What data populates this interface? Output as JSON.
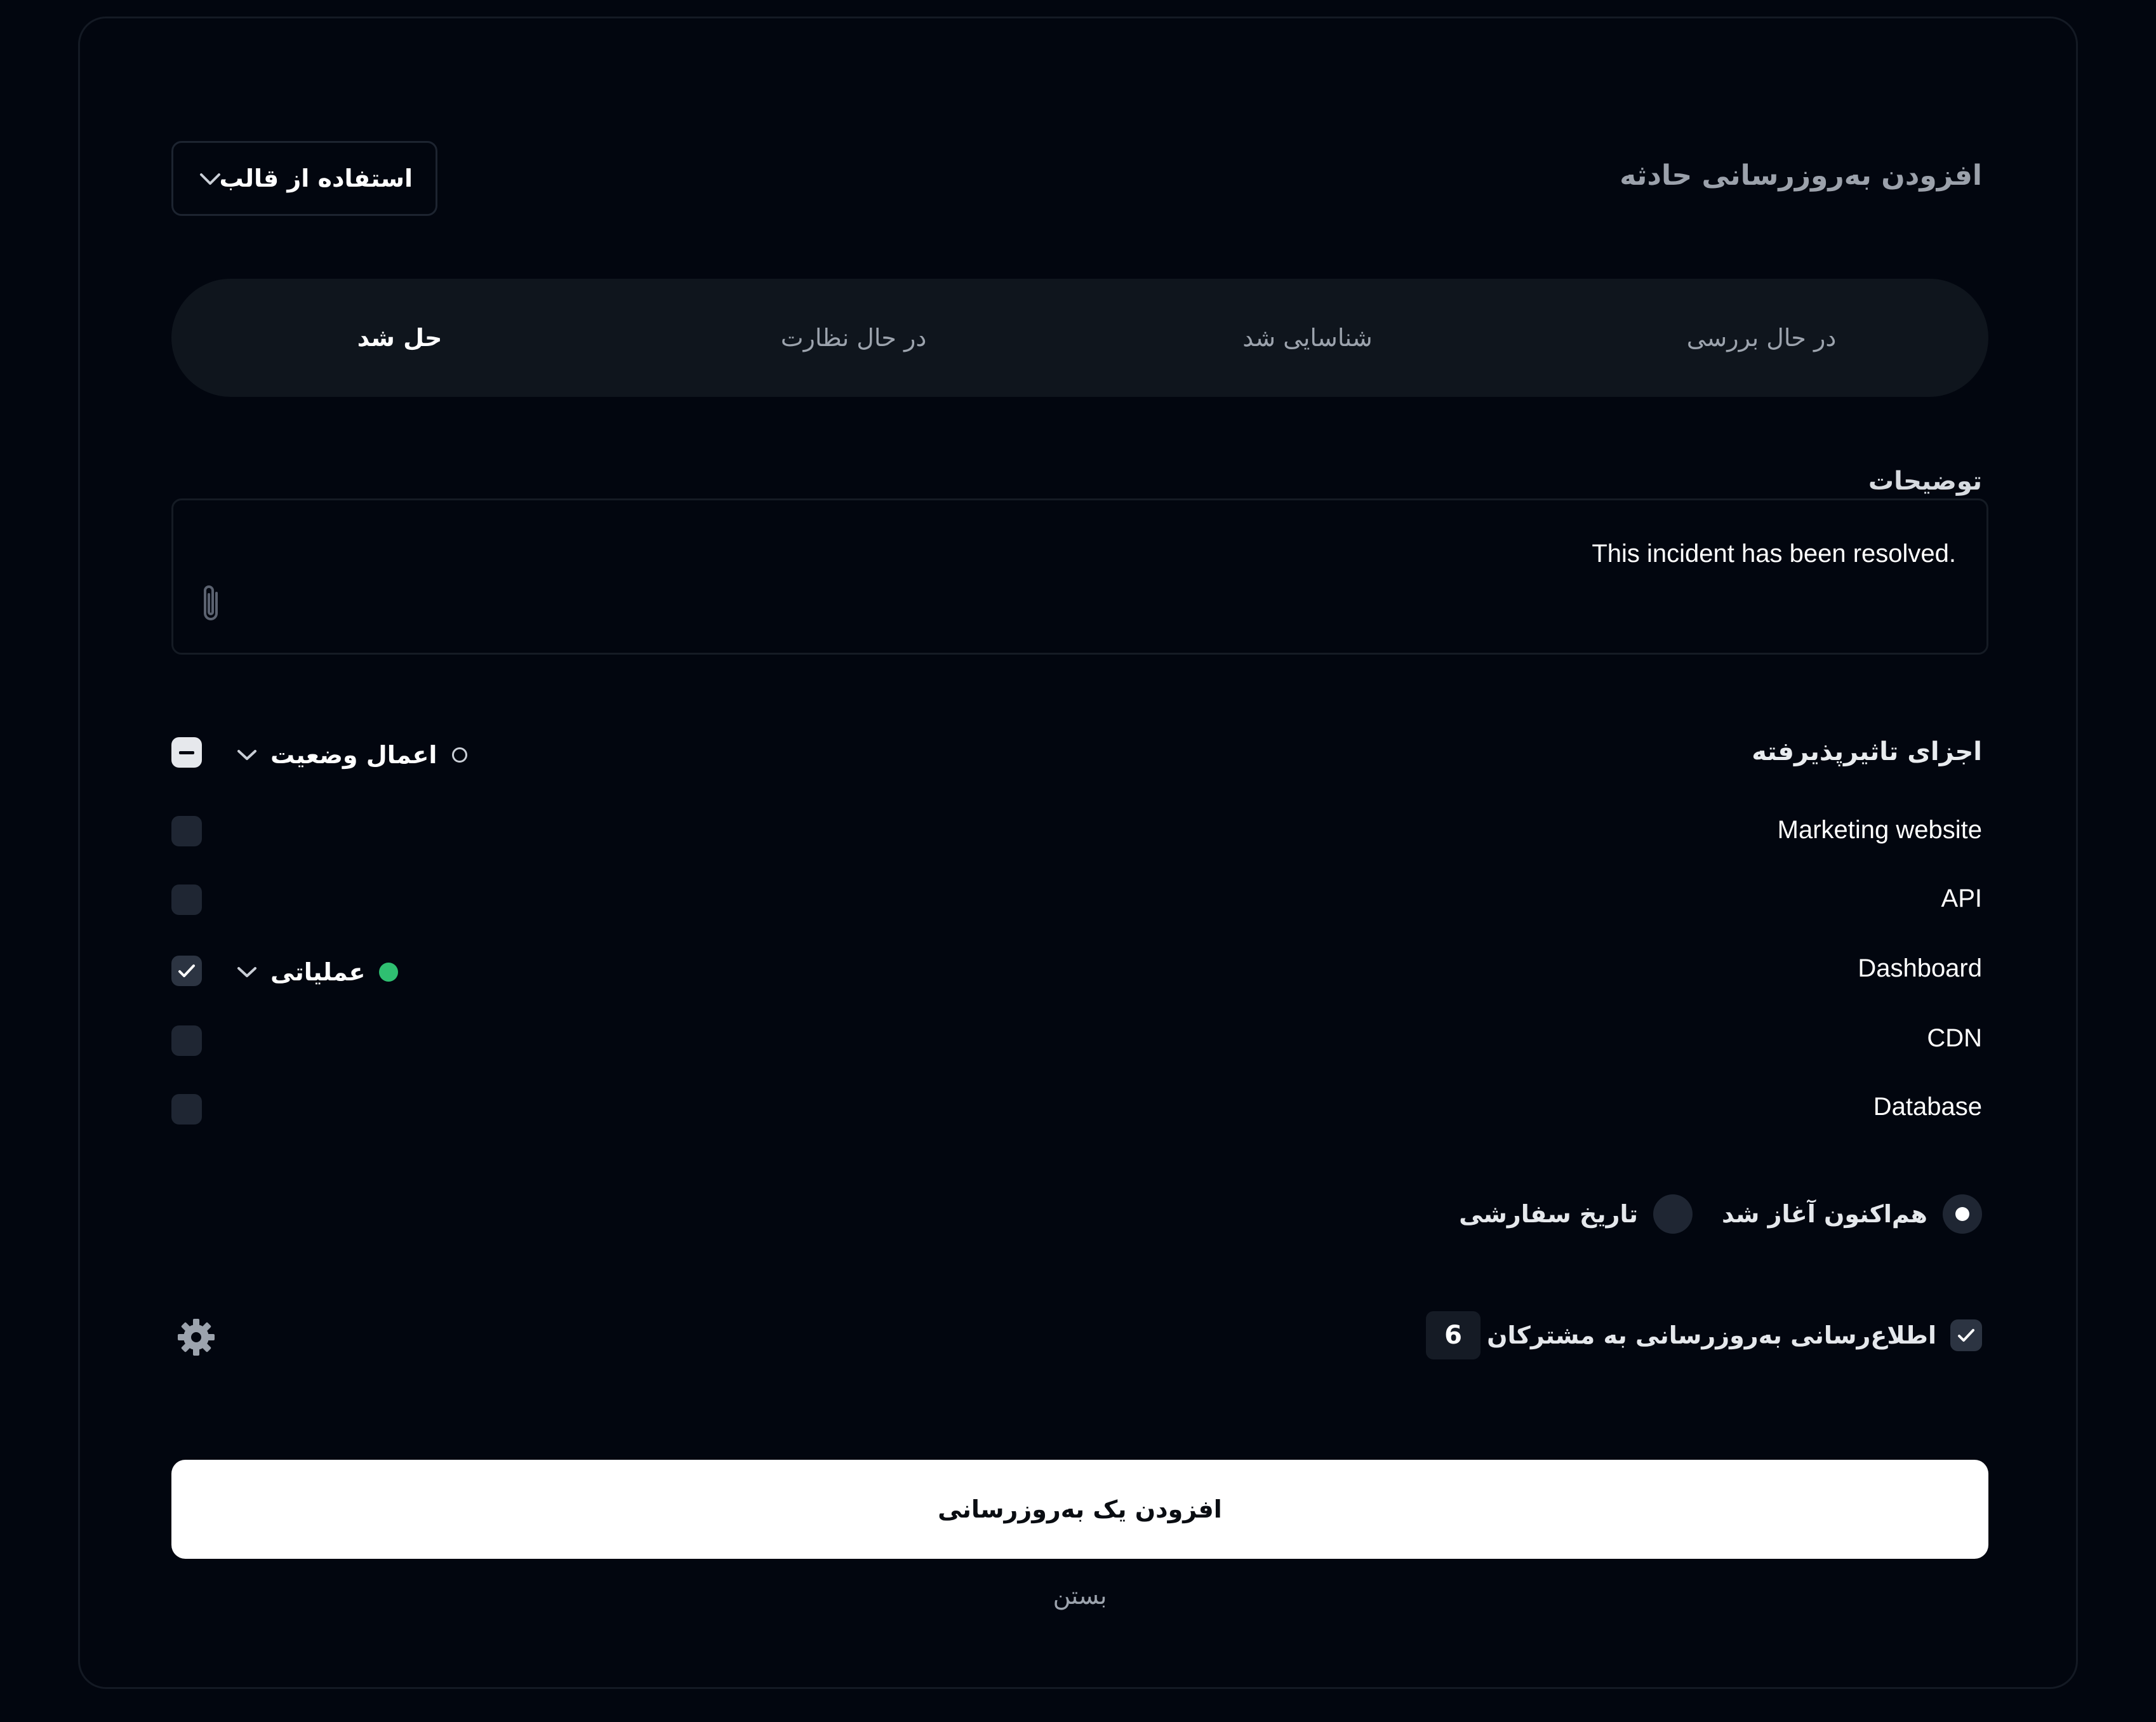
{
  "dialog": {
    "title": "افزودن به‌روزرسانی حادثه",
    "template_button": "استفاده از قالب"
  },
  "status_tabs": [
    {
      "label": "در حال بررسی",
      "active": false
    },
    {
      "label": "شناسایی شد",
      "active": false
    },
    {
      "label": "در حال نظارت",
      "active": false
    },
    {
      "label": "حل شد",
      "active": true
    }
  ],
  "description": {
    "label": "توضیحات",
    "value": "This incident has been resolved."
  },
  "components": {
    "header": "اجزای تاثیرپذیرفته",
    "apply_status_label": "اعمال وضعیت",
    "items": [
      {
        "name": "Marketing website",
        "checked": false
      },
      {
        "name": "API",
        "checked": false
      },
      {
        "name": "Dashboard",
        "checked": true,
        "status": "عملیاتی",
        "status_color": "#2fbf71"
      },
      {
        "name": "CDN",
        "checked": false
      },
      {
        "name": "Database",
        "checked": false
      }
    ]
  },
  "timing": {
    "options": [
      {
        "label": "هم‌اکنون آغاز شد",
        "selected": true
      },
      {
        "label": "تاریخ سفارشی",
        "selected": false
      }
    ]
  },
  "notify": {
    "label": "اطلاع‌رسانی به‌روزرسانی به مشترکان",
    "checked": true,
    "subscriber_count": "6"
  },
  "actions": {
    "submit": "افزودن یک به‌روزرسانی",
    "close": "بستن"
  },
  "colors": {
    "background": "#02060f",
    "accent_green": "#2fbf71",
    "primary_button": "#ffffff"
  }
}
